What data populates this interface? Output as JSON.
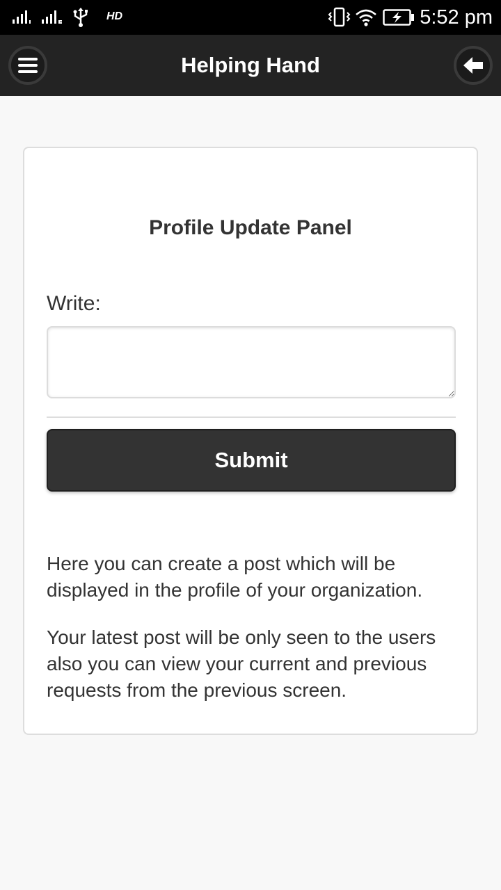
{
  "status_bar": {
    "network_label": "HD",
    "time": "5:52 pm"
  },
  "header": {
    "title": "Helping Hand",
    "menu_icon": "hamburger-menu-icon",
    "back_icon": "arrow-left-icon"
  },
  "panel": {
    "title": "Profile Update Panel",
    "write_label": "Write:",
    "write_value": "",
    "submit_label": "Submit",
    "info_paragraphs": [
      "Here you can create a post which will be displayed in the profile of your organization.",
      "Your latest post will be only seen to the users also you can view your current and previous requests from the previous screen."
    ]
  },
  "colors": {
    "status_bar_bg": "#000000",
    "header_bg": "#232323",
    "page_bg": "#f8f8f8",
    "button_bg": "#333333",
    "text": "#333333"
  }
}
